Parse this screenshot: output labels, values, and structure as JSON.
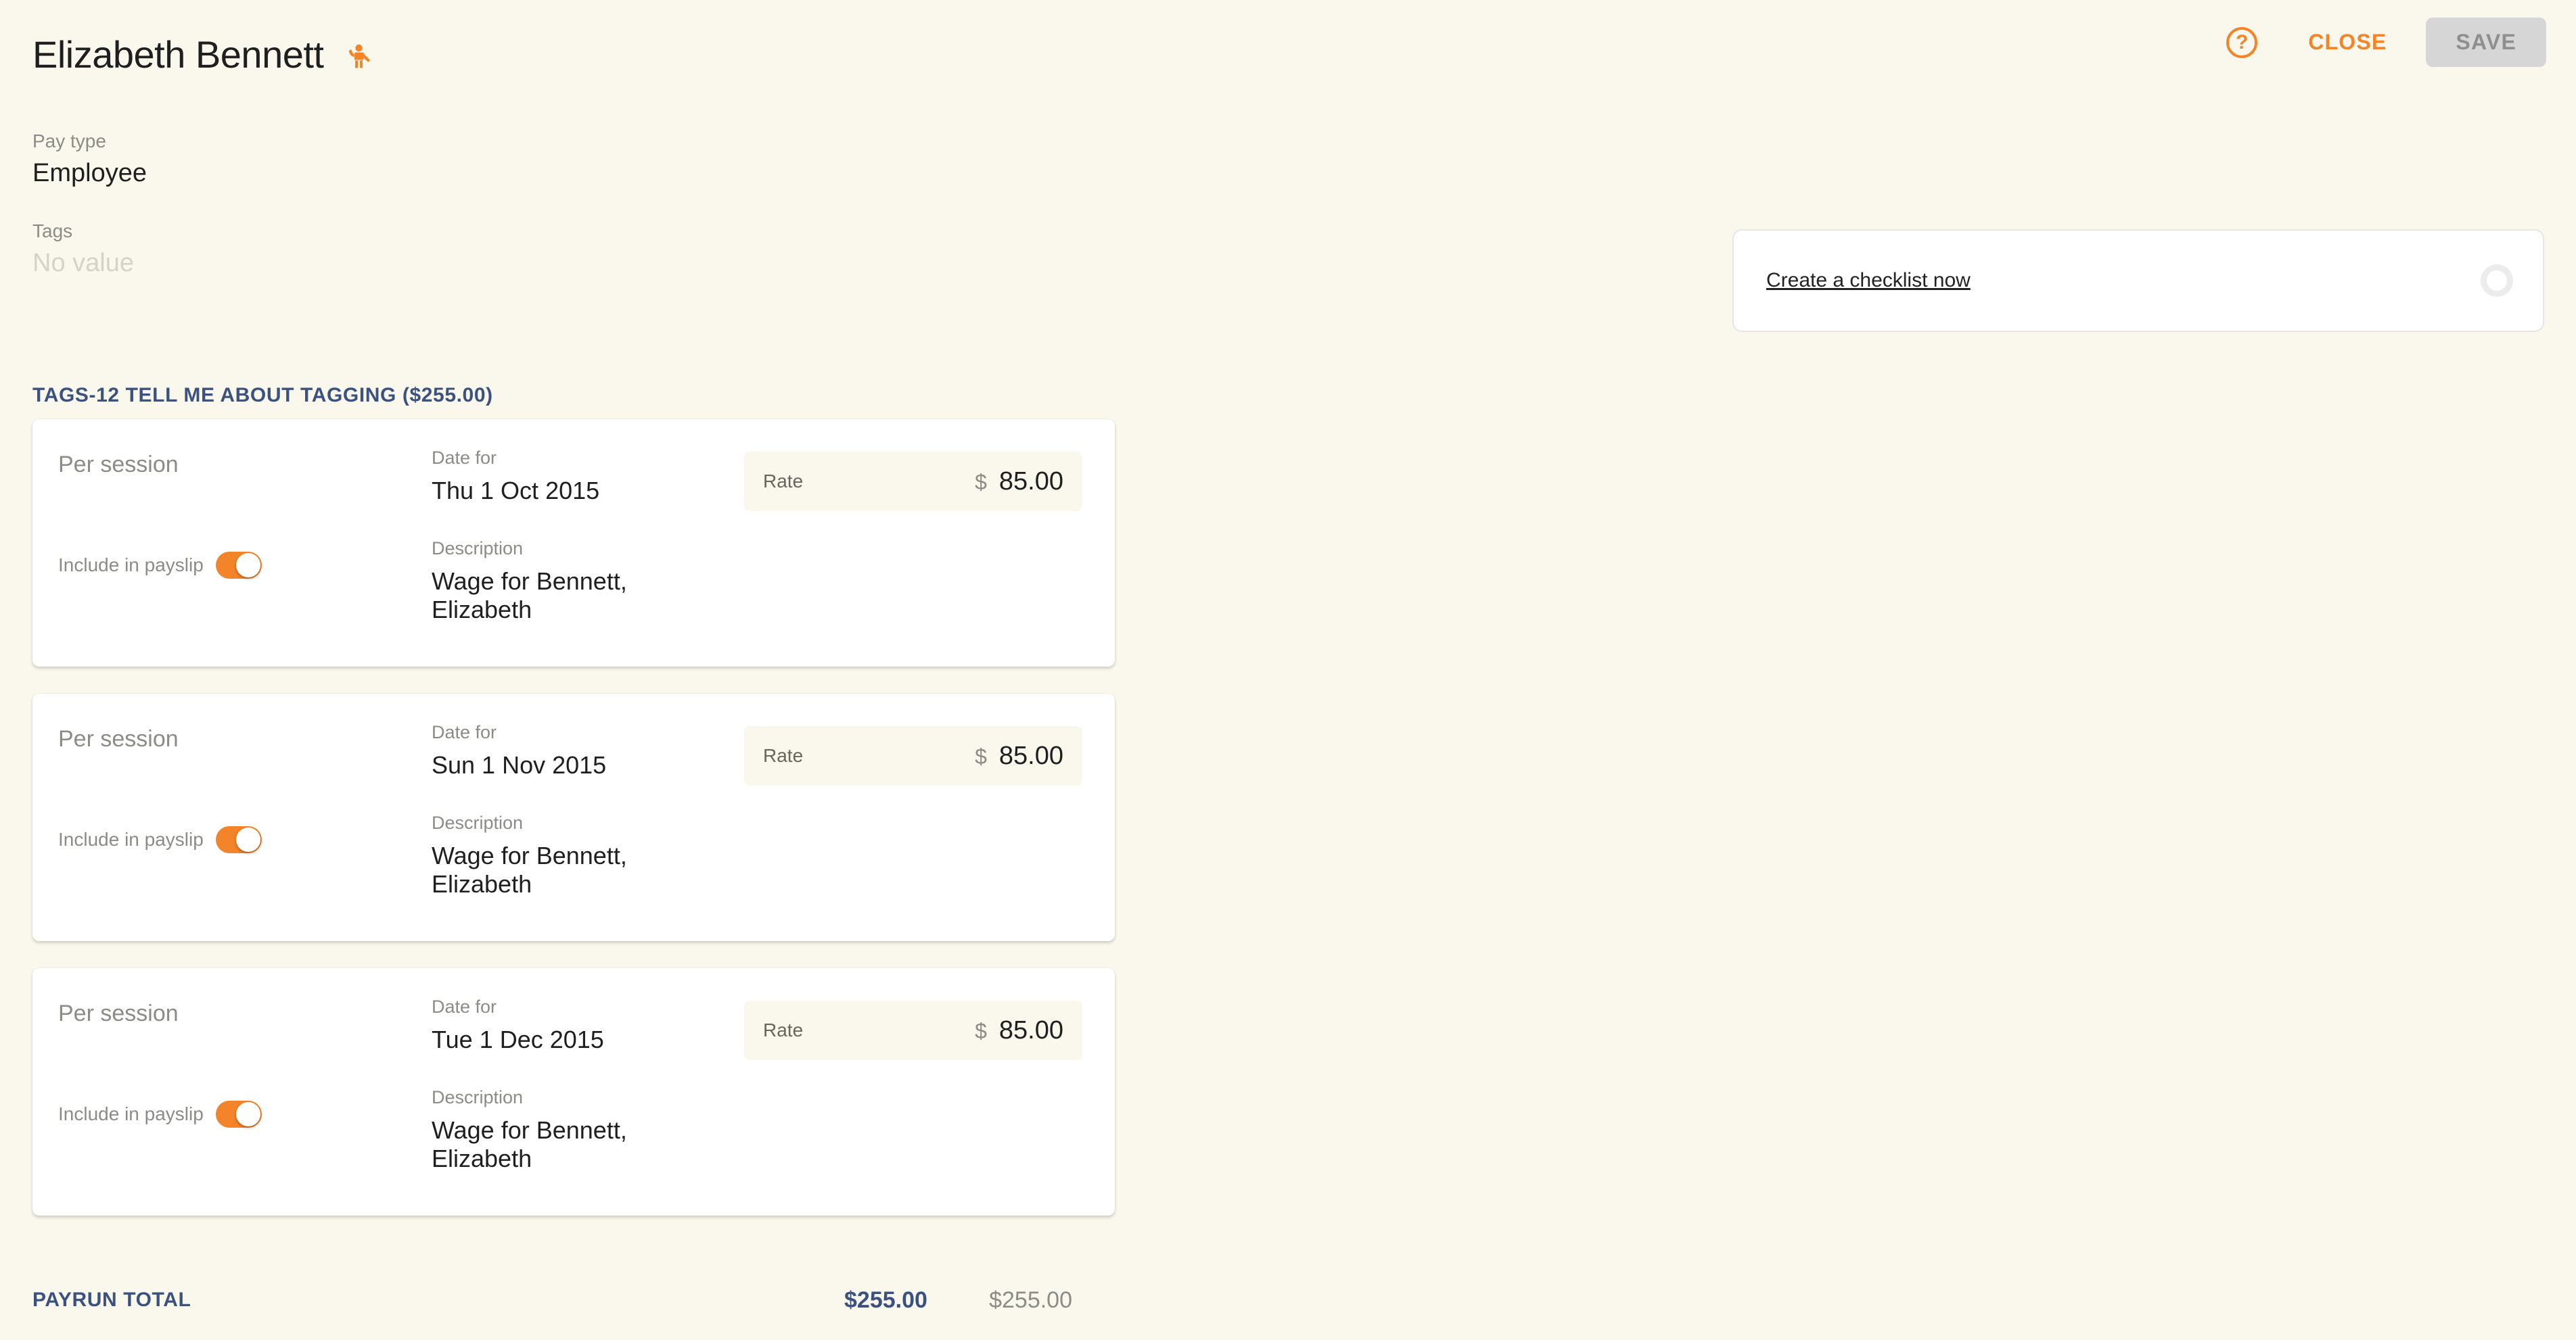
{
  "header": {
    "title": "Elizabeth Bennett",
    "title_icon": "person-raising-hand-icon",
    "help_label": "?",
    "close_label": "CLOSE",
    "save_label": "SAVE"
  },
  "fields": {
    "pay_type": {
      "label": "Pay type",
      "value": "Employee"
    },
    "tags": {
      "label": "Tags",
      "value": "No value"
    }
  },
  "checklist": {
    "link_label": "Create a checklist now",
    "status": "loading"
  },
  "section": {
    "header": "TAGS-12 TELL ME ABOUT TAGGING ($255.00)"
  },
  "line_items": [
    {
      "pay_basis": "Per session",
      "payslip_label": "Include in payslip",
      "payslip_on": true,
      "date_label": "Date for",
      "date_value": "Thu 1 Oct 2015",
      "description_label": "Description",
      "description_value": "Wage for Bennett, Elizabeth",
      "rate_label": "Rate",
      "rate_currency": "$",
      "rate_value": "85.00"
    },
    {
      "pay_basis": "Per session",
      "payslip_label": "Include in payslip",
      "payslip_on": true,
      "date_label": "Date for",
      "date_value": "Sun 1 Nov 2015",
      "description_label": "Description",
      "description_value": "Wage for Bennett, Elizabeth",
      "rate_label": "Rate",
      "rate_currency": "$",
      "rate_value": "85.00"
    },
    {
      "pay_basis": "Per session",
      "payslip_label": "Include in payslip",
      "payslip_on": true,
      "date_label": "Date for",
      "date_value": "Tue 1 Dec 2015",
      "description_label": "Description",
      "description_value": "Wage for Bennett, Elizabeth",
      "rate_label": "Rate",
      "rate_currency": "$",
      "rate_value": "85.00"
    }
  ],
  "totals": {
    "label": "PAYRUN TOTAL",
    "primary": "$255.00",
    "secondary": "$255.00"
  },
  "colors": {
    "background": "#faf8ed",
    "accent_orange": "#f3842a",
    "navy": "#3b5280",
    "muted_text": "#8c8c86",
    "card_white": "#ffffff",
    "disabled_button": "#d6d6d6"
  }
}
